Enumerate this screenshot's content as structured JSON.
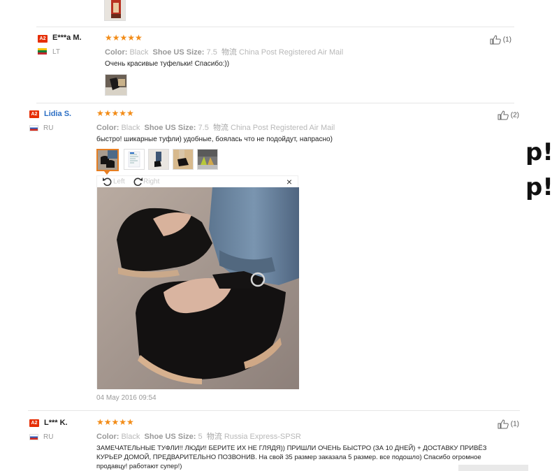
{
  "reviews": [
    {
      "badge": "A2",
      "name": "E***a M.",
      "country": "LT",
      "color_label": "Color:",
      "color_value": "Black",
      "size_label": "Shoe US Size:",
      "size_value": "7.5",
      "ship_label": "物流",
      "ship_value": "China Post Registered Air Mail",
      "text": "Очень красивые туфельки! Спасибо:))",
      "likes": "(1)"
    },
    {
      "badge": "A2",
      "name": "Lidia S.",
      "country": "RU",
      "color_label": "Color:",
      "color_value": "Black",
      "size_label": "Shoe US Size:",
      "size_value": "7.5",
      "ship_label": "物流",
      "ship_value": "China Post Registered Air Mail",
      "text": "быстро! шикарные туфли) удобные, боялась что не подойдут, напрасно)",
      "likes": "(2)",
      "viewer": {
        "left_label": "Left",
        "right_label": "Right",
        "close": "×"
      },
      "date": "04 May 2016 09:54"
    },
    {
      "badge": "A2",
      "name": "L*** K.",
      "country": "RU",
      "color_label": "Color:",
      "color_value": "Black",
      "size_label": "Shoe US Size:",
      "size_value": "5",
      "ship_label": "物流",
      "ship_value": "Russia Express-SPSR",
      "text": "ЗАМЕЧАТЕЛЬНЫЕ ТУФЛИ!! ЛЮДИ! БЕРИТЕ ИХ НЕ ГЛЯДЯ)) ПРИШЛИ ОЧЕНЬ БЫСТРО (ЗА 10 ДНЕЙ) + ДОСТАВКУ ПРИВЁЗ КУРЬЕР ДОМОЙ, ПРЕДВАРИТЕЛЬНО ПОЗВОНИВ. На свой 35 размер заказала 5 размер. все подошло) Спасибо огромное продавцу! работают супер!)",
      "likes": "(1)"
    }
  ],
  "side_text": [
    "p!",
    "p!"
  ],
  "stars": "★★★★★",
  "colors": {
    "accent": "#f28c18",
    "badge": "#e62e04",
    "link": "#2b6ec4"
  }
}
